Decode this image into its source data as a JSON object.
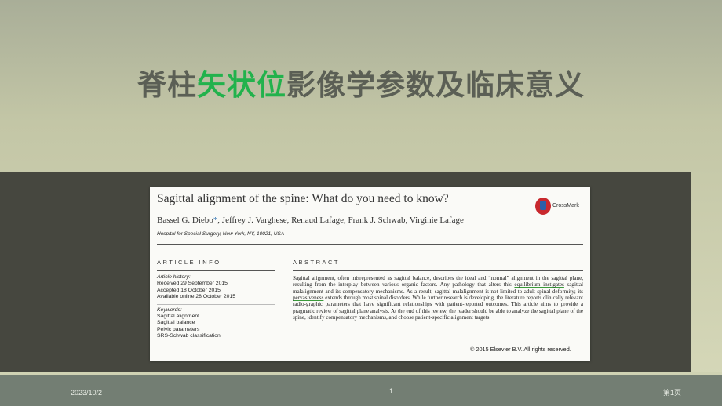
{
  "slide": {
    "title_prefix": "脊柱",
    "title_highlight": "矢状位",
    "title_suffix": "影像学参数及临床意义",
    "highlight_color": "#22b24c"
  },
  "paper": {
    "title": "Sagittal alignment of the spine: What do you need to know?",
    "authors_first": "Bassel G. Diebo",
    "authors_star": "*",
    "authors_rest": ", Jeffrey J. Varghese, Renaud Lafage, Frank J. Schwab, Virginie Lafage",
    "affiliation": "Hospital for Special Surgery, New York, NY, 10021, USA",
    "crossmark_label": "CrossMark",
    "article_info_header": "ARTICLE INFO",
    "abstract_header": "ABSTRACT",
    "history_label": "Article history:",
    "history": [
      "Received 29 September 2015",
      "Accepted 18 October 2015",
      "Available online 28 October 2015"
    ],
    "keywords_label": "Keywords:",
    "keywords": [
      "Sagittal alignment",
      "Sagittal balance",
      "Pelvic parameters",
      "SRS-Schwab classification"
    ],
    "abstract_text_1": "Sagittal alignment, often misrepresented as sagittal balance, describes the ideal and “normal” alignment in the sagittal plane, resulting from the interplay between various organic factors. Any pathology that alters this ",
    "abstract_ul_1": "equilibrium instigates",
    "abstract_text_2": " sagittal malalignment and its compensatory mechanisms. As a result, sagittal malalignment is not limited to adult spinal deformity; its ",
    "abstract_ul_2": "pervasiveness",
    "abstract_text_3": " extends through most spinal disorders. While further research is developing, the literature reports clinically relevant radio-graphic parameters that have significant relationships with patient-reported outcomes. This article aims to provide a ",
    "abstract_ul_3": "pragmatic",
    "abstract_text_4": " review of sagittal plane analysis. At the end of this review, the reader should be able to analyze the sagittal plane of the spine, identify compensatory mechanisms, and choose patient-specific alignment targets.",
    "copyright": "© 2015 Elsevier B.V. All rights reserved."
  },
  "footer": {
    "date": "2023/10/2",
    "page_number": "1",
    "page_label": "第1页"
  }
}
